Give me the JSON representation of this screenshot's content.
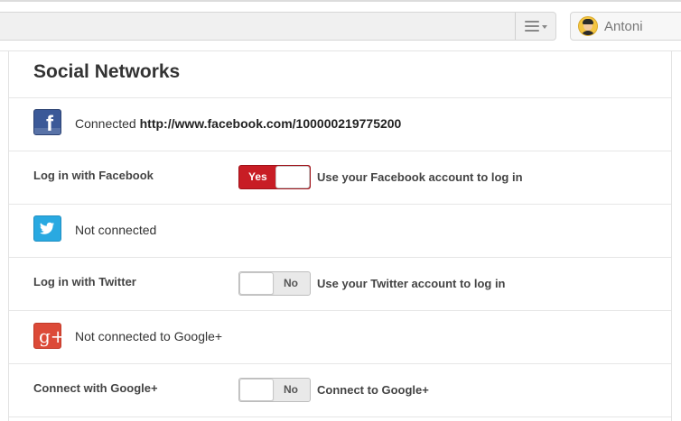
{
  "header": {
    "user_name": "Antoni"
  },
  "panel": {
    "title": "Social Networks",
    "facebook": {
      "status_prefix": "Connected",
      "status_url": "http://www.facebook.com/100000219775200",
      "option_label": "Log in with Facebook",
      "toggle_value": "Yes",
      "toggle_on": true,
      "option_desc": "Use your Facebook account to log in"
    },
    "twitter": {
      "status": "Not connected",
      "option_label": "Log in with Twitter",
      "toggle_value": "No",
      "toggle_on": false,
      "option_desc": "Use your Twitter account to log in"
    },
    "google": {
      "status": "Not connected to Google+",
      "icon_glyph": "g+",
      "option_label": "Connect with Google+",
      "toggle_value": "No",
      "toggle_on": false,
      "option_desc": "Connect to Google+"
    }
  },
  "colors": {
    "facebook": "#3b5998",
    "twitter": "#29a9e1",
    "google": "#dc4a38",
    "toggle_on": "#c81d25"
  }
}
